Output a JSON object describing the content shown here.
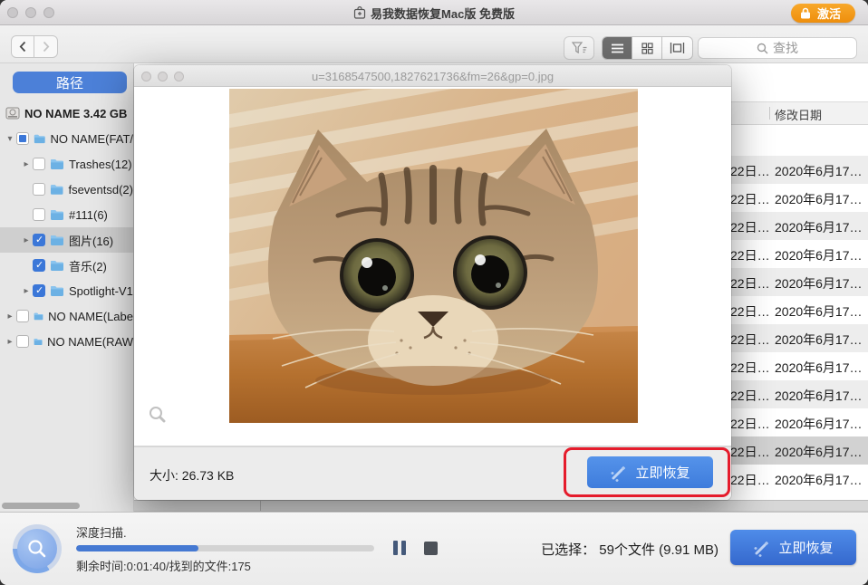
{
  "window": {
    "title": "易我数据恢复Mac版 免费版",
    "activate_button": "激活"
  },
  "toolbar": {
    "search_placeholder": "查找"
  },
  "sidebar": {
    "path_button": "路径",
    "device_label": "NO NAME 3.42 GB",
    "tree": [
      {
        "label": "NO NAME(FAT/",
        "level": 0,
        "disclosure": "open",
        "check": "partial",
        "selected": false
      },
      {
        "label": "Trashes(12)",
        "level": 1,
        "disclosure": "closed",
        "check": "unchecked",
        "selected": false
      },
      {
        "label": "fseventsd(2)",
        "level": 1,
        "disclosure": "none",
        "check": "unchecked",
        "selected": false
      },
      {
        "label": "#111(6)",
        "level": 1,
        "disclosure": "none",
        "check": "unchecked",
        "selected": false
      },
      {
        "label": "图片(16)",
        "level": 1,
        "disclosure": "closed",
        "check": "checked",
        "selected": true
      },
      {
        "label": "音乐(2)",
        "level": 1,
        "disclosure": "none",
        "check": "checked",
        "selected": false
      },
      {
        "label": "Spotlight-V1",
        "level": 1,
        "disclosure": "closed",
        "check": "checked",
        "selected": false
      },
      {
        "label": "NO NAME(Labe",
        "level": 0,
        "disclosure": "closed",
        "check": "unchecked",
        "selected": false
      },
      {
        "label": "NO NAME(RAW",
        "level": 0,
        "disclosure": "closed",
        "check": "unchecked",
        "selected": false
      }
    ]
  },
  "table": {
    "modified_header": "修改日期",
    "selected_row_index": 10,
    "rows": [
      {
        "c1": "22日…",
        "c2": "2020年6月17…"
      },
      {
        "c1": "22日…",
        "c2": "2020年6月17…"
      },
      {
        "c1": "22日…",
        "c2": "2020年6月17…"
      },
      {
        "c1": "22日…",
        "c2": "2020年6月17…"
      },
      {
        "c1": "22日…",
        "c2": "2020年6月17…"
      },
      {
        "c1": "22日…",
        "c2": "2020年6月17…"
      },
      {
        "c1": "22日…",
        "c2": "2020年6月17…"
      },
      {
        "c1": "22日…",
        "c2": "2020年6月17…"
      },
      {
        "c1": "22日…",
        "c2": "2020年6月17…"
      },
      {
        "c1": "22日…",
        "c2": "2020年6月17…"
      },
      {
        "c1": "22日…",
        "c2": "2020年6月17…"
      },
      {
        "c1": "22日…",
        "c2": "2020年6月17…"
      }
    ]
  },
  "preview": {
    "title": "u=3168547500,1827621736&fm=26&gp=0.jpg",
    "size_label": "大小:",
    "size_value": "26.73 KB",
    "recover_button": "立即恢复"
  },
  "statusbar": {
    "scan_label": "深度扫描.",
    "progress_percent": 41,
    "eta_label": "剩余时间:0:01:40/找到的文件:175",
    "selected_label": "已选择：",
    "selected_value": "59个文件 (9.91 MB)",
    "recover_button": "立即恢复"
  },
  "colors": {
    "accent_blue": "#4579d2",
    "button_blue": "#4a86e2",
    "activate_orange": "#f29b1d",
    "annotation_red": "#e51c2c",
    "folder_blue": "#6cb1e4",
    "selected_row_gray": "#d2d2d2"
  }
}
